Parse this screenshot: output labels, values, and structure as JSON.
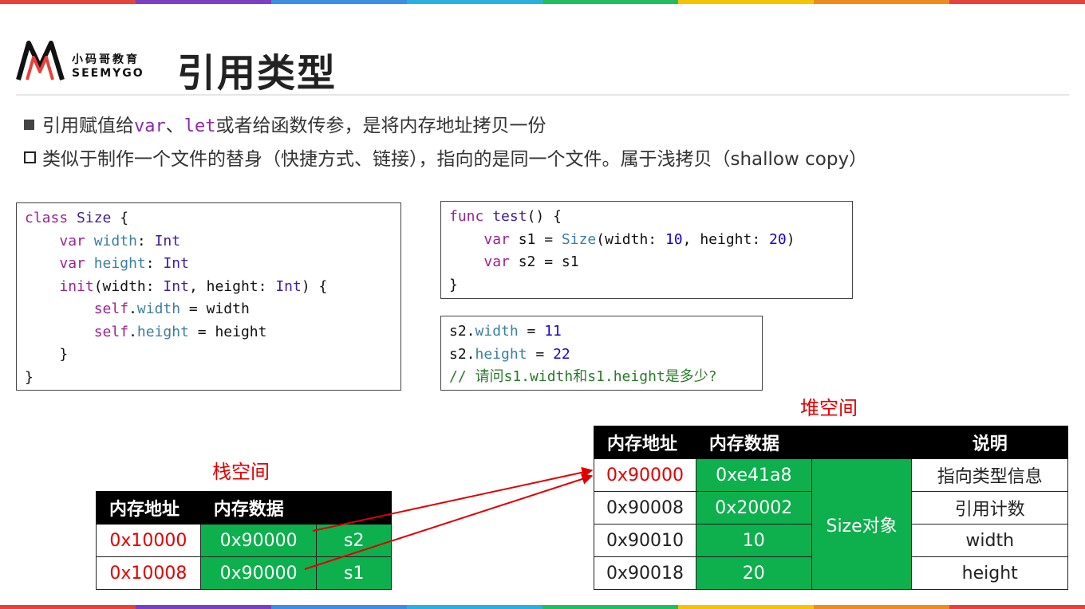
{
  "brand": {
    "name_cn": "小码哥教育",
    "name_en": "SEEMYGO"
  },
  "page_title": "引用类型",
  "bullets": {
    "b1_pre": "引用赋值给",
    "b1_kw1": "var",
    "b1_mid": "、",
    "b1_kw2": "let",
    "b1_post": "或者给函数传参，是将内存地址拷贝一份",
    "b2": "类似于制作一个文件的替身（快捷方式、链接），指向的是同一个文件。属于浅拷贝（shallow copy）"
  },
  "code_class": {
    "l1_kw": "class",
    "l1_name": "Size",
    "l1_end": " {",
    "l2_kw": "var",
    "l2_prop": "width",
    "l2_colon": ": ",
    "l2_type": "Int",
    "l3_kw": "var",
    "l3_prop": "height",
    "l3_colon": ": ",
    "l3_type": "Int",
    "l4_kw": "init",
    "l4_a": "(width: ",
    "l4_t1": "Int",
    "l4_b": ", height: ",
    "l4_t2": "Int",
    "l4_c": ") {",
    "l5_self": "self",
    "l5_dot": ".",
    "l5_prop": "width",
    "l5_rest": " = width",
    "l6_self": "self",
    "l6_dot": ".",
    "l6_prop": "height",
    "l6_rest": " = height",
    "l7": "}",
    "l8": "}"
  },
  "code_func": {
    "l1_kw": "func",
    "l1_name": "test",
    "l1_rest": "() {",
    "l2_kw": "var",
    "l2_a": " s1 = ",
    "l2_type": "Size",
    "l2_b": "(width: ",
    "l2_n1": "10",
    "l2_c": ", height: ",
    "l2_n2": "20",
    "l2_d": ")",
    "l3_kw": "var",
    "l3_rest": " s2 = s1",
    "l4": "}"
  },
  "code_assign": {
    "l1_a": "s2.",
    "l1_prop": "width",
    "l1_b": " = ",
    "l1_num": "11",
    "l2_a": "s2.",
    "l2_prop": "height",
    "l2_b": " = ",
    "l2_num": "22",
    "l3_comment": "// 请问s1.width和s1.height是多少?"
  },
  "heap_label": "堆空间",
  "stack_label": "栈空间",
  "stack_table": {
    "headers": [
      "内存地址",
      "内存数据",
      ""
    ],
    "rows": [
      {
        "addr": "0x10000",
        "data": "0x90000",
        "name": "s2"
      },
      {
        "addr": "0x10008",
        "data": "0x90000",
        "name": "s1"
      }
    ]
  },
  "heap_table": {
    "headers": [
      "内存地址",
      "内存数据",
      "",
      "说明"
    ],
    "object_label": "Size对象",
    "rows": [
      {
        "addr": "0x90000",
        "data": "0xe41a8",
        "desc": "指向类型信息"
      },
      {
        "addr": "0x90008",
        "data": "0x20002",
        "desc": "引用计数"
      },
      {
        "addr": "0x90010",
        "data": "10",
        "desc": "width"
      },
      {
        "addr": "0x90018",
        "data": "20",
        "desc": "height"
      }
    ]
  },
  "colors": {
    "accent_green": "#0db04c",
    "accent_red": "#e00000",
    "stripe": [
      "#e8413c",
      "#7b3fc4",
      "#3a8ee6",
      "#2ab0e0",
      "#1fbf5f",
      "#f5c400",
      "#f08a1c",
      "#e8413c"
    ]
  }
}
